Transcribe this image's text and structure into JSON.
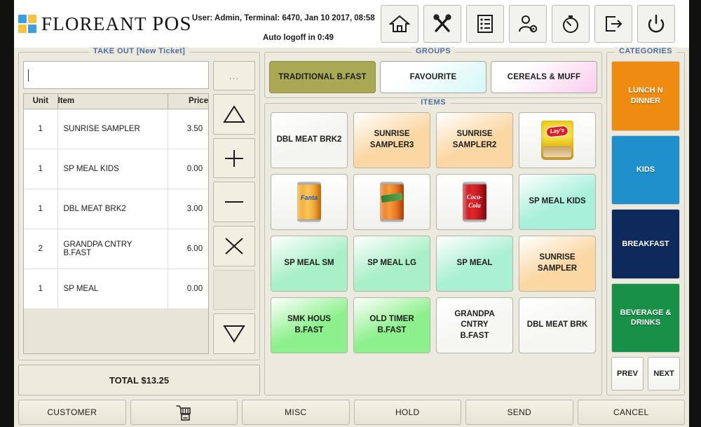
{
  "header": {
    "brand_floreant": "FLOREANT",
    "brand_pos": "POS",
    "user_info": "User: Admin, Terminal: 6470, Jan 10 2017, 08:58",
    "auto_logoff": "Auto logoff in 0:49",
    "icons": [
      {
        "name": "home-icon",
        "label": "Home"
      },
      {
        "name": "tools-icon",
        "label": "Manage"
      },
      {
        "name": "list-icon",
        "label": "Order List"
      },
      {
        "name": "user-settings-icon",
        "label": "User Settings"
      },
      {
        "name": "timer-icon",
        "label": "Clock"
      },
      {
        "name": "logout-icon",
        "label": "Log Out"
      },
      {
        "name": "power-icon",
        "label": "Shut Down"
      }
    ]
  },
  "ticket": {
    "title": "TAKE OUT [New Ticket]",
    "search_value": "",
    "search_placeholder": "",
    "columns": [
      "Unit",
      "Item",
      "Price"
    ],
    "rows": [
      {
        "unit": "1",
        "item": "SUNRISE SAMPLER",
        "price": "3.50"
      },
      {
        "unit": "1",
        "item": "SP MEAL KIDS",
        "price": "0.00"
      },
      {
        "unit": "1",
        "item": "DBL MEAT BRK2",
        "price": "3.00"
      },
      {
        "unit": "2",
        "item": "GRANDPA CNTRY B.FAST",
        "price": "6.00"
      },
      {
        "unit": "1",
        "item": "SP MEAL",
        "price": "0.00"
      }
    ],
    "total_label": "TOTAL $13.25",
    "side_buttons": [
      {
        "name": "more-options-button",
        "icon": "ellipsis-icon",
        "label": "..."
      },
      {
        "name": "scroll-up-button",
        "icon": "triangle-up-icon",
        "label": ""
      },
      {
        "name": "increase-quantity-button",
        "icon": "plus-icon",
        "label": ""
      },
      {
        "name": "decrease-quantity-button",
        "icon": "minus-icon",
        "label": ""
      },
      {
        "name": "delete-item-button",
        "icon": "cross-icon",
        "label": ""
      },
      {
        "name": "disabled-button",
        "icon": "blank-icon",
        "label": ""
      },
      {
        "name": "scroll-down-button",
        "icon": "triangle-down-icon",
        "label": ""
      }
    ]
  },
  "groups": {
    "title": "GROUPS",
    "buttons": [
      {
        "label": "TRADITIONAL B.FAST",
        "color": "#a9a855",
        "selected": true
      },
      {
        "label": "FAVOURITE",
        "color": "#d4f7f7",
        "selected": false
      },
      {
        "label": "CEREALS & MUFF",
        "color": "#f9cdec",
        "selected": false
      }
    ]
  },
  "items": {
    "title": "ITEMS",
    "buttons": [
      {
        "label": "DBL MEAT BRK2",
        "color": "#f4f4f1",
        "image": ""
      },
      {
        "label": "SUNRISE SAMPLER3",
        "color": "#fbd7a4",
        "image": ""
      },
      {
        "label": "SUNRISE SAMPLER2",
        "color": "#fbd7a4",
        "image": ""
      },
      {
        "label": "",
        "color": "#f6f6f3",
        "image": "lays-chips"
      },
      {
        "label": "",
        "color": "#f6f6f3",
        "image": "fanta-can"
      },
      {
        "label": "",
        "color": "#f6f6f3",
        "image": "crush-can"
      },
      {
        "label": "",
        "color": "#f6f6f3",
        "image": "coca-cola-can"
      },
      {
        "label": "SP MEAL KIDS",
        "color": "#a9f0da",
        "image": ""
      },
      {
        "label": "SP MEAL SM",
        "color": "#a9f0c8",
        "image": ""
      },
      {
        "label": "SP MEAL LG",
        "color": "#a9f0c8",
        "image": ""
      },
      {
        "label": "SP MEAL",
        "color": "#a9f0d4",
        "image": ""
      },
      {
        "label": "SUNRISE SAMPLER",
        "color": "#fbd7a4",
        "image": ""
      },
      {
        "label": "SMK HOUS B.FAST",
        "color": "#8cf08c",
        "image": ""
      },
      {
        "label": "OLD TIMER B.FAST",
        "color": "#8cf08c",
        "image": ""
      },
      {
        "label": "GRANDPA CNTRY B.FAST",
        "color": "#f6f6f3",
        "image": ""
      },
      {
        "label": "DBL MEAT BRK",
        "color": "#f6f6f3",
        "image": ""
      }
    ]
  },
  "categories": {
    "title": "CATEGORIES",
    "buttons": [
      {
        "label": "LUNCH N DINNER",
        "color": "#ef8b10"
      },
      {
        "label": "KIDS",
        "color": "#2090cd"
      },
      {
        "label": "BREAKFAST",
        "color": "#0e2a5c"
      },
      {
        "label": "BEVERAGE & DRINKS",
        "color": "#189048"
      }
    ],
    "prev_label": "PREV",
    "next_label": "NEXT"
  },
  "footer": {
    "buttons": [
      {
        "label": "CUSTOMER",
        "icon": ""
      },
      {
        "label": "",
        "icon": "shopping-cart-icon"
      },
      {
        "label": "MISC",
        "icon": ""
      },
      {
        "label": "HOLD",
        "icon": ""
      },
      {
        "label": "SEND",
        "icon": ""
      },
      {
        "label": "CANCEL",
        "icon": ""
      }
    ]
  }
}
